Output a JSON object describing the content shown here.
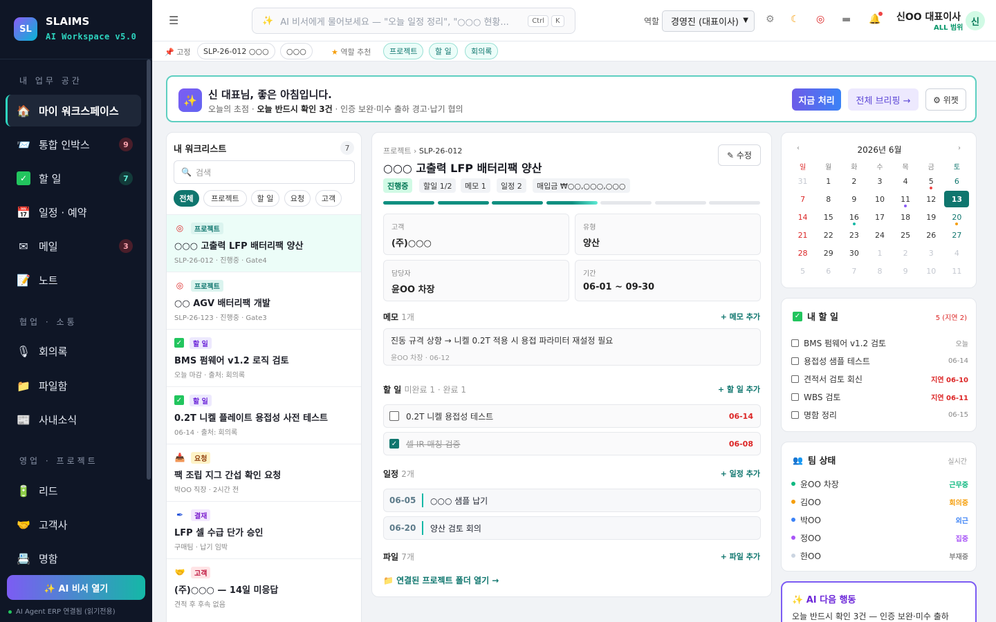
{
  "sidebar": {
    "logo": "SL",
    "brand": "SLAIMS",
    "brand_sub": "AI Workspace v5.0",
    "sections": [
      {
        "title": "내 업무 공간"
      },
      {
        "title": "협업 · 소통"
      },
      {
        "title": "영업 · 프로젝트"
      }
    ],
    "items": [
      {
        "label": "마이 워크스페이스",
        "icon": "home-icon"
      },
      {
        "label": "통합 인박스",
        "badge": "9",
        "icon": "inbox-icon"
      },
      {
        "label": "할 일",
        "badge": "7",
        "icon": "check-icon"
      },
      {
        "label": "일정 · 예약",
        "icon": "calendar-icon"
      },
      {
        "label": "메일",
        "badge": "3",
        "icon": "mail-icon"
      },
      {
        "label": "노트",
        "icon": "note-icon"
      },
      {
        "label": "회의록",
        "icon": "mic-icon"
      },
      {
        "label": "파일함",
        "icon": "folder-icon"
      },
      {
        "label": "사내소식",
        "icon": "news-icon"
      },
      {
        "label": "리드",
        "icon": "battery-icon"
      },
      {
        "label": "고객사",
        "icon": "handshake-icon"
      },
      {
        "label": "명함",
        "icon": "card-icon"
      }
    ],
    "ai_button": "✨ AI 비서 열기",
    "status": "AI Agent ERP 연결됨 (읽기전용)"
  },
  "topbar": {
    "search_placeholder": "AI 비서에게 물어보세요 — \"오늘 일정 정리\", \"○○○ 현황...",
    "kbd_ctrl": "Ctrl",
    "kbd_k": "K",
    "role_label": "역할",
    "role_value": "경영진 (대표이사)",
    "user_name": "신OO 대표이사",
    "user_scope": "ALL 범위",
    "avatar": "신"
  },
  "pinbar": {
    "pin_label": "고정",
    "pins": [
      "SLP-26-012 ○○○",
      "○○○"
    ],
    "role_label": "역할 추천",
    "recs": [
      "프로젝트",
      "할 일",
      "회의록"
    ]
  },
  "greeting": {
    "title": "신 대표님, 좋은 아침입니다.",
    "sub_prefix": "오늘의 초점 · ",
    "sub_bold": "오늘 반드시 확인 3건",
    "sub_suffix": " · 인증 보완·미수 출하 경고·납기 협의",
    "btn_now": "지금 처리",
    "btn_brief": "전체 브리핑 →",
    "btn_widget": "⚙ 위젯"
  },
  "worklist": {
    "title": "내 워크리스트",
    "count": "7",
    "search_placeholder": "검색",
    "filters": [
      "전체",
      "프로젝트",
      "할 일",
      "요청",
      "고객"
    ],
    "items": [
      {
        "tag": "프로젝트",
        "icon": "target-icon",
        "name": "○○○ 고출력 LFP 배터리팩 양산",
        "meta": "SLP-26-012 · 진행중 · Gate4"
      },
      {
        "tag": "프로젝트",
        "icon": "target-icon",
        "name": "○○ AGV 배터리팩 개발",
        "meta": "SLP-26-123 · 진행중 · Gate3"
      },
      {
        "tag": "할 일",
        "icon": "check-icon",
        "name": "BMS 펌웨어 v1.2 로직 검토",
        "meta": "오늘 마감 · 출처: 회의록"
      },
      {
        "tag": "할 일",
        "icon": "check-icon",
        "name": "0.2T 니켈 플레이트 용접성 사전 테스트",
        "meta": "06-14 · 출처: 회의록"
      },
      {
        "tag": "요청",
        "icon": "inbox-tray-icon",
        "name": "팩 조립 지그 간섭 확인 요청",
        "meta": "박OO 직장 · 2시간 전"
      },
      {
        "tag": "결재",
        "icon": "pen-icon",
        "name": "LFP 셀 수급 단가 승인",
        "meta": "구매팀 · 납기 임박"
      },
      {
        "tag": "고객",
        "icon": "handshake-icon",
        "name": "(주)○○○ — 14일 미응답",
        "meta": "견적 후 후속 없음"
      }
    ]
  },
  "detail": {
    "crumb_parent": "프로젝트",
    "crumb_current": "SLP-26-012",
    "title": "○○○ 고출력 LFP 배터리팩 양산",
    "edit": "✎ 수정",
    "pills": [
      "진행중",
      "할일 1/2",
      "메모 1",
      "일정 2",
      "매입금 ₩○○,○○○,○○○"
    ],
    "progress": [
      1,
      1,
      1,
      0.5,
      0,
      0,
      0
    ],
    "fields": [
      {
        "label": "고객",
        "value": "(주)○○○"
      },
      {
        "label": "유형",
        "value": "양산"
      },
      {
        "label": "담당자",
        "value": "윤OO 차장"
      },
      {
        "label": "기간",
        "value": "06-01 ~ 09-30"
      }
    ],
    "memo_title": "메모",
    "memo_count": "1개",
    "memo_add": "+ 메모 추가",
    "memo_text": "진동 규격 상향 → 니켈 0.2T 적용 시 용접 파라미터 재설정 필요",
    "memo_meta": "윤OO 차장 · 06-12",
    "todo_title": "할 일",
    "todo_count": "미완료 1 · 완료 1",
    "todo_add": "+ 할 일 추가",
    "todos": [
      {
        "text": "0.2T 니켈 용접성 테스트",
        "due": "06-14",
        "done": false
      },
      {
        "text": "셀 IR 매칭 검증",
        "due": "06-08",
        "done": true
      }
    ],
    "event_title": "일정",
    "event_count": "2개",
    "event_add": "+ 일정 추가",
    "events": [
      {
        "date": "06-05",
        "text": "○○○ 샘플 납기"
      },
      {
        "date": "06-20",
        "text": "양산 검토 회의"
      }
    ],
    "file_title": "파일",
    "file_count": "7개",
    "file_add": "+ 파일 추가",
    "folder_link": "연결된 프로젝트 폴더 열기 →"
  },
  "calendar": {
    "title": "2026년 6월",
    "prev": "‹",
    "next": "›",
    "weekdays": [
      "일",
      "월",
      "화",
      "수",
      "목",
      "금",
      "토"
    ],
    "days": [
      "31",
      "1",
      "2",
      "3",
      "4",
      "5",
      "6",
      "7",
      "8",
      "9",
      "10",
      "11",
      "12",
      "13",
      "14",
      "15",
      "16",
      "17",
      "18",
      "19",
      "20",
      "21",
      "22",
      "23",
      "24",
      "25",
      "26",
      "27",
      "28",
      "29",
      "30",
      "1",
      "2",
      "3",
      "4",
      "5",
      "6",
      "7",
      "8",
      "9",
      "10",
      "11"
    ],
    "today": "13",
    "dots": {
      "5": "#ef4444",
      "11": "#8b5cf6",
      "16": "#14b8a6",
      "20": "#f59e0b"
    }
  },
  "mytasks": {
    "title": "내 할 일",
    "summary": "5 (지연 2)",
    "items": [
      {
        "text": "BMS 펌웨어 v1.2 검토",
        "due": "오늘",
        "late": false
      },
      {
        "text": "용접성 샘플 테스트",
        "due": "06-14",
        "late": false
      },
      {
        "text": "견적서 검토 회신",
        "due": "지연 06-10",
        "late": true
      },
      {
        "text": "WBS 검토",
        "due": "지연 06-11",
        "late": true
      },
      {
        "text": "명함 정리",
        "due": "06-15",
        "late": false
      }
    ]
  },
  "team": {
    "title": "팀 상태",
    "right": "실시간",
    "members": [
      {
        "name": "윤OO 차장",
        "status": "근무중",
        "color": "#10b981"
      },
      {
        "name": "김OO",
        "status": "회의중",
        "color": "#f59e0b"
      },
      {
        "name": "박OO",
        "status": "외근",
        "color": "#3b82f6"
      },
      {
        "name": "정OO",
        "status": "집중",
        "color": "#a855f7"
      },
      {
        "name": "한OO",
        "status": "부재중",
        "color": "#cbd5e1"
      }
    ]
  },
  "ainext": {
    "title": "✨ AI 다음 행동",
    "text": "오늘 반드시 확인 3건 — 인증 보완·미수 출하"
  }
}
